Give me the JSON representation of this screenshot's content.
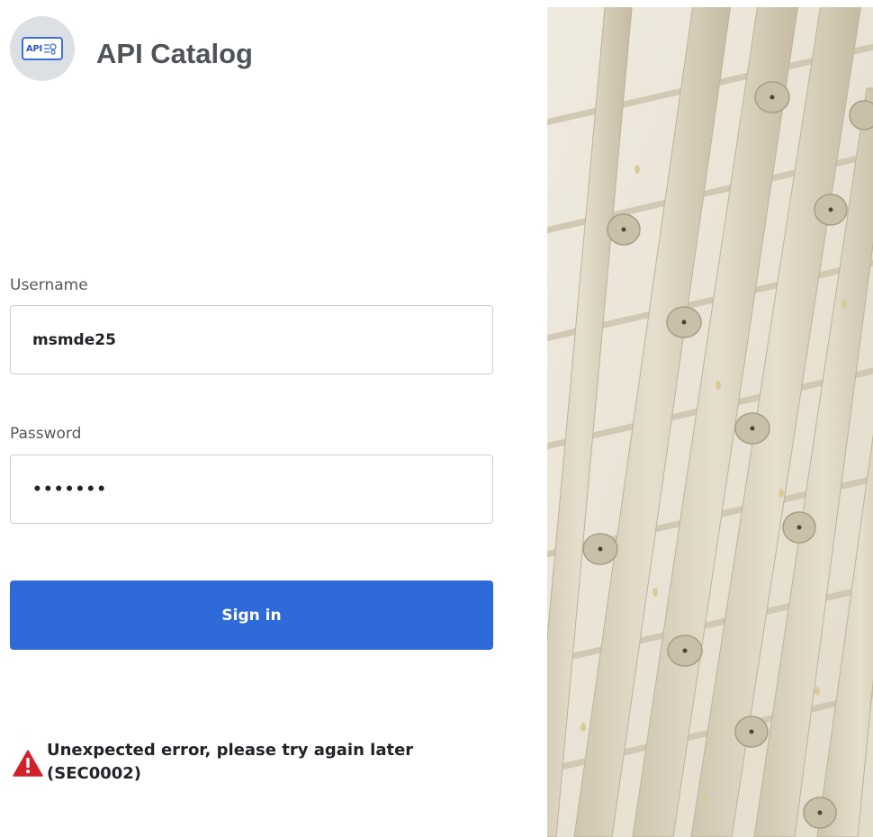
{
  "app": {
    "title": "API Catalog",
    "logo_text": "API"
  },
  "form": {
    "username_label": "Username",
    "username_value": "msmde25",
    "password_label": "Password",
    "password_value": "•••••••",
    "submit_label": "Sign in"
  },
  "error": {
    "message_line1": "Unexpected error, please try again later",
    "message_line2": "(SEC0002)",
    "icon": "warning-triangle-icon",
    "icon_color": "#d0202a"
  },
  "colors": {
    "accent": "#2f6ad9",
    "image_tone": "#ddd6c4"
  }
}
